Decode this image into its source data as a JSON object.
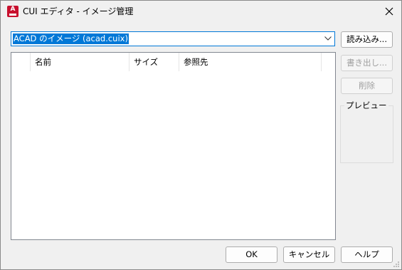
{
  "window": {
    "title": "CUI エディタ - イメージ管理",
    "app_icon_letter": "A"
  },
  "source_combo": {
    "selected": "ACAD のイメージ (acad.cuix)"
  },
  "buttons": {
    "load": "読み込み...",
    "export": "書き出し...",
    "delete": "削除",
    "ok": "OK",
    "cancel": "キャンセル",
    "help": "ヘルプ"
  },
  "list": {
    "columns": [
      "名前",
      "サイズ",
      "参照先"
    ],
    "rows": []
  },
  "preview": {
    "label": "プレビュー"
  },
  "colors": {
    "accent": "#0078d7",
    "app_icon": "#c8102e",
    "disabled_text": "#a0a0a0"
  }
}
